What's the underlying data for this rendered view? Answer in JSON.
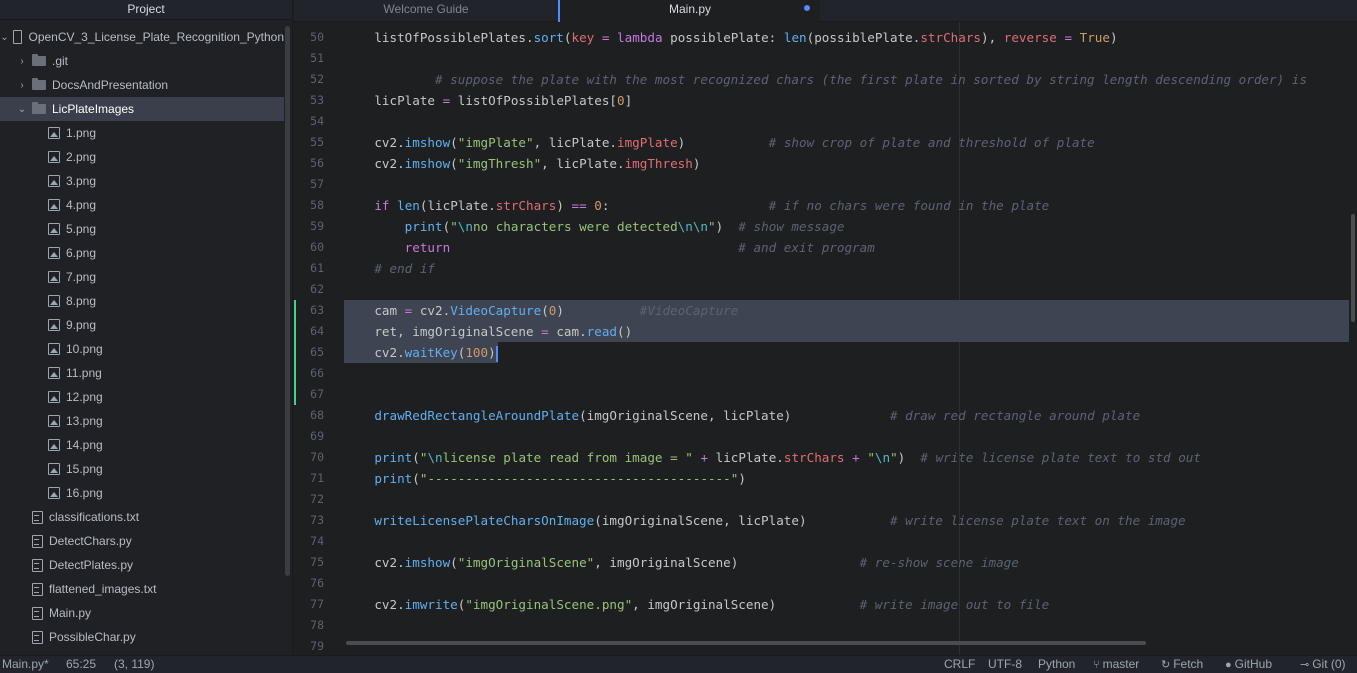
{
  "tree": {
    "header": "Project",
    "root": "OpenCV_3_License_Plate_Recognition_Python",
    "items": [
      {
        "label": ".git",
        "type": "folder",
        "chevron": "›",
        "indent": 1,
        "selected": false
      },
      {
        "label": "DocsAndPresentation",
        "type": "folder",
        "chevron": "›",
        "indent": 1,
        "selected": false
      },
      {
        "label": "LicPlateImages",
        "type": "folder",
        "chevron": "⌄",
        "indent": 1,
        "selected": true
      },
      {
        "label": "1.png",
        "type": "image",
        "indent": 2
      },
      {
        "label": "2.png",
        "type": "image",
        "indent": 2
      },
      {
        "label": "3.png",
        "type": "image",
        "indent": 2
      },
      {
        "label": "4.png",
        "type": "image",
        "indent": 2
      },
      {
        "label": "5.png",
        "type": "image",
        "indent": 2
      },
      {
        "label": "6.png",
        "type": "image",
        "indent": 2
      },
      {
        "label": "7.png",
        "type": "image",
        "indent": 2
      },
      {
        "label": "8.png",
        "type": "image",
        "indent": 2
      },
      {
        "label": "9.png",
        "type": "image",
        "indent": 2
      },
      {
        "label": "10.png",
        "type": "image",
        "indent": 2
      },
      {
        "label": "11.png",
        "type": "image",
        "indent": 2
      },
      {
        "label": "12.png",
        "type": "image",
        "indent": 2
      },
      {
        "label": "13.png",
        "type": "image",
        "indent": 2
      },
      {
        "label": "14.png",
        "type": "image",
        "indent": 2
      },
      {
        "label": "15.png",
        "type": "image",
        "indent": 2
      },
      {
        "label": "16.png",
        "type": "image",
        "indent": 2
      },
      {
        "label": "classifications.txt",
        "type": "file",
        "indent": 1
      },
      {
        "label": "DetectChars.py",
        "type": "file",
        "indent": 1
      },
      {
        "label": "DetectPlates.py",
        "type": "file",
        "indent": 1
      },
      {
        "label": "flattened_images.txt",
        "type": "file",
        "indent": 1
      },
      {
        "label": "Main.py",
        "type": "file",
        "indent": 1
      },
      {
        "label": "PossibleChar.py",
        "type": "file",
        "indent": 1
      }
    ]
  },
  "tabs": [
    {
      "label": "Welcome Guide",
      "active": false,
      "modified": false
    },
    {
      "label": "Main.py",
      "active": true,
      "modified": true
    }
  ],
  "editor": {
    "lines": [
      {
        "n": "50",
        "tokens": [
          [
            "",
            "    listOfPossiblePlates."
          ],
          [
            "fn",
            "sort"
          ],
          [
            "",
            "("
          ],
          [
            "at",
            "key"
          ],
          [
            "",
            " "
          ],
          [
            "op",
            "="
          ],
          [
            "",
            " "
          ],
          [
            "kw",
            "lambda"
          ],
          [
            "",
            " possiblePlate: "
          ],
          [
            "fn",
            "len"
          ],
          [
            "",
            "(possiblePlate."
          ],
          [
            "at",
            "strChars"
          ],
          [
            "",
            "), "
          ],
          [
            "at",
            "reverse"
          ],
          [
            "",
            " "
          ],
          [
            "op",
            "="
          ],
          [
            "",
            " "
          ],
          [
            "num",
            "True"
          ],
          [
            "",
            ")"
          ]
        ]
      },
      {
        "n": "51",
        "tokens": []
      },
      {
        "n": "52",
        "tokens": [
          [
            "cm",
            "            # suppose the plate with the most recognized chars (the first plate in sorted by string length descending order) is"
          ]
        ]
      },
      {
        "n": "53",
        "tokens": [
          [
            "",
            "    licPlate "
          ],
          [
            "op",
            "="
          ],
          [
            "",
            " listOfPossiblePlates["
          ],
          [
            "num",
            "0"
          ],
          [
            "",
            "]"
          ]
        ]
      },
      {
        "n": "54",
        "tokens": []
      },
      {
        "n": "55",
        "tokens": [
          [
            "",
            "    cv2."
          ],
          [
            "fn",
            "imshow"
          ],
          [
            "",
            "("
          ],
          [
            "str",
            "\"imgPlate\""
          ],
          [
            "",
            ", licPlate."
          ],
          [
            "at",
            "imgPlate"
          ],
          [
            "",
            ")           "
          ],
          [
            "cm",
            "# show crop of plate and threshold of plate"
          ]
        ]
      },
      {
        "n": "56",
        "tokens": [
          [
            "",
            "    cv2."
          ],
          [
            "fn",
            "imshow"
          ],
          [
            "",
            "("
          ],
          [
            "str",
            "\"imgThresh\""
          ],
          [
            "",
            ", licPlate."
          ],
          [
            "at",
            "imgThresh"
          ],
          [
            "",
            ")"
          ]
        ]
      },
      {
        "n": "57",
        "tokens": []
      },
      {
        "n": "58",
        "tokens": [
          [
            "",
            "    "
          ],
          [
            "kw",
            "if"
          ],
          [
            "",
            " "
          ],
          [
            "fn",
            "len"
          ],
          [
            "",
            "(licPlate."
          ],
          [
            "at",
            "strChars"
          ],
          [
            "",
            ") "
          ],
          [
            "op",
            "=="
          ],
          [
            "",
            " "
          ],
          [
            "num",
            "0"
          ],
          [
            "",
            ":                     "
          ],
          [
            "cm",
            "# if no chars were found in the plate"
          ]
        ]
      },
      {
        "n": "59",
        "tokens": [
          [
            "",
            "        "
          ],
          [
            "fn",
            "print"
          ],
          [
            "",
            "("
          ],
          [
            "str",
            "\""
          ],
          [
            "esc",
            "\\n"
          ],
          [
            "str",
            "no characters were detected"
          ],
          [
            "esc",
            "\\n\\n"
          ],
          [
            "str",
            "\""
          ],
          [
            "",
            ")  "
          ],
          [
            "cm",
            "# show message"
          ]
        ]
      },
      {
        "n": "60",
        "tokens": [
          [
            "",
            "        "
          ],
          [
            "kw",
            "return"
          ],
          [
            "",
            "                                      "
          ],
          [
            "cm",
            "# and exit program"
          ]
        ]
      },
      {
        "n": "61",
        "tokens": [
          [
            "cm",
            "    # end if"
          ]
        ]
      },
      {
        "n": "62",
        "tokens": []
      },
      {
        "n": "63",
        "tokens": [
          [
            "",
            "    cam "
          ],
          [
            "op",
            "="
          ],
          [
            "",
            " cv2."
          ],
          [
            "fn",
            "VideoCapture"
          ],
          [
            "",
            "("
          ],
          [
            "num",
            "0"
          ],
          [
            "",
            ")          "
          ],
          [
            "cm",
            "#VideoCapture"
          ]
        ],
        "sel": "full"
      },
      {
        "n": "64",
        "tokens": [
          [
            "",
            "    ret, imgOriginalScene "
          ],
          [
            "op",
            "="
          ],
          [
            "",
            " cam."
          ],
          [
            "fn",
            "read"
          ],
          [
            "",
            "()"
          ]
        ],
        "sel": "full"
      },
      {
        "n": "65",
        "tokens": [
          [
            "",
            "    cv2."
          ],
          [
            "fn",
            "waitKey"
          ],
          [
            "",
            "("
          ],
          [
            "num",
            "100"
          ],
          [
            "",
            ")"
          ]
        ],
        "sel": "partial",
        "cursor": true
      },
      {
        "n": "66",
        "tokens": []
      },
      {
        "n": "67",
        "tokens": []
      },
      {
        "n": "68",
        "tokens": [
          [
            "",
            "    "
          ],
          [
            "fn",
            "drawRedRectangleAroundPlate"
          ],
          [
            "",
            "(imgOriginalScene, licPlate)             "
          ],
          [
            "cm",
            "# draw red rectangle around plate"
          ]
        ]
      },
      {
        "n": "69",
        "tokens": []
      },
      {
        "n": "70",
        "tokens": [
          [
            "",
            "    "
          ],
          [
            "fn",
            "print"
          ],
          [
            "",
            "("
          ],
          [
            "str",
            "\""
          ],
          [
            "esc",
            "\\n"
          ],
          [
            "str",
            "license plate read from image = \""
          ],
          [
            "",
            " "
          ],
          [
            "op",
            "+"
          ],
          [
            "",
            " licPlate."
          ],
          [
            "at",
            "strChars"
          ],
          [
            "",
            " "
          ],
          [
            "op",
            "+"
          ],
          [
            "",
            " "
          ],
          [
            "str",
            "\""
          ],
          [
            "esc",
            "\\n"
          ],
          [
            "str",
            "\""
          ],
          [
            "",
            ")  "
          ],
          [
            "cm",
            "# write license plate text to std out"
          ]
        ]
      },
      {
        "n": "71",
        "tokens": [
          [
            "",
            "    "
          ],
          [
            "fn",
            "print"
          ],
          [
            "",
            "("
          ],
          [
            "str",
            "\"----------------------------------------\""
          ],
          [
            "",
            ")"
          ]
        ]
      },
      {
        "n": "72",
        "tokens": []
      },
      {
        "n": "73",
        "tokens": [
          [
            "",
            "    "
          ],
          [
            "fn",
            "writeLicensePlateCharsOnImage"
          ],
          [
            "",
            "(imgOriginalScene, licPlate)           "
          ],
          [
            "cm",
            "# write license plate text on the image"
          ]
        ]
      },
      {
        "n": "74",
        "tokens": []
      },
      {
        "n": "75",
        "tokens": [
          [
            "",
            "    cv2."
          ],
          [
            "fn",
            "imshow"
          ],
          [
            "",
            "("
          ],
          [
            "str",
            "\"imgOriginalScene\""
          ],
          [
            "",
            ", imgOriginalScene)                "
          ],
          [
            "cm",
            "# re-show scene image"
          ]
        ]
      },
      {
        "n": "76",
        "tokens": []
      },
      {
        "n": "77",
        "tokens": [
          [
            "",
            "    cv2."
          ],
          [
            "fn",
            "imwrite"
          ],
          [
            "",
            "("
          ],
          [
            "str",
            "\"imgOriginalScene.png\""
          ],
          [
            "",
            ", imgOriginalScene)           "
          ],
          [
            "cm",
            "# write image out to file"
          ]
        ]
      },
      {
        "n": "78",
        "tokens": []
      },
      {
        "n": "79",
        "tokens": []
      }
    ]
  },
  "status": {
    "file": "Main.py*",
    "cursor": "65:25",
    "selection": "(3, 119)",
    "line_ending": "CRLF",
    "encoding": "UTF-8",
    "grammar": "Python",
    "branch": "master",
    "fetch": "Fetch",
    "github": "GitHub",
    "git": "Git (0)"
  },
  "colors": {
    "accent": "#528bff",
    "selection": "#3e4451",
    "modified_line": "#43d08a"
  }
}
